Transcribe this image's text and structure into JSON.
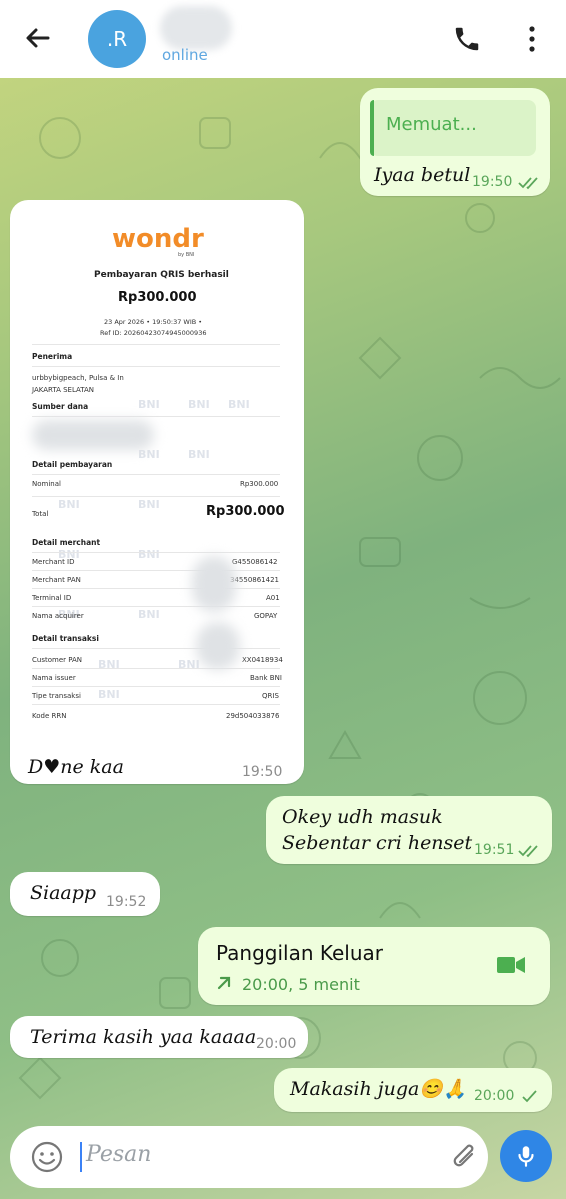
{
  "header": {
    "avatar_initials": ".R",
    "status": "online",
    "icons": [
      "back-arrow-icon",
      "phone-icon",
      "more-vert-icon"
    ]
  },
  "messages": [
    {
      "id": "m1",
      "direction": "out",
      "quote": "Memuat...",
      "text": "Iyaa betul",
      "time": "19:50",
      "status": "read"
    },
    {
      "id": "m2",
      "direction": "in",
      "type": "image",
      "caption": "D♥ne kaa",
      "time": "19:50"
    },
    {
      "id": "m3",
      "direction": "out",
      "lines": [
        "Okey udh masuk",
        "Sebentar cri henset"
      ],
      "time": "19:51",
      "status": "read"
    },
    {
      "id": "m4",
      "direction": "in",
      "text": "Siaapp",
      "time": "19:52"
    },
    {
      "id": "m5",
      "direction": "out",
      "type": "call",
      "title": "Panggilan Keluar",
      "detail": "20:00, 5 menit",
      "icon": "video-camera-icon"
    },
    {
      "id": "m6",
      "direction": "in",
      "text": "Terima kasih yaa kaaaa",
      "time": "20:00"
    },
    {
      "id": "m7",
      "direction": "out",
      "text": "Makasih juga😊🙏",
      "time": "20:00",
      "status": "sent"
    }
  ],
  "receipt": {
    "brand": "wondr",
    "brand_sub": "by BNI",
    "title": "Pembayaran QRIS berhasil",
    "amount": "Rp300.000",
    "datetime": "23 Apr 2026 • 19:50:37 WIB •",
    "ref": "Ref ID: 20260423074945000936",
    "penerima_label": "Penerima",
    "penerima_line1": "urbbybigpeach, Pulsa & In",
    "penerima_line2": "JAKARTA SELATAN",
    "sumber_label": "Sumber dana",
    "detail_pembayaran_label": "Detail pembayaran",
    "nominal_label": "Nominal",
    "nominal_value": "Rp300.000",
    "total_label": "Total",
    "total_value": "Rp300.000",
    "detail_merchant_label": "Detail merchant",
    "merchant_rows": [
      {
        "label": "Merchant ID",
        "value": "G455086142"
      },
      {
        "label": "Merchant PAN",
        "value": "34550861421"
      },
      {
        "label": "Terminal ID",
        "value": "A01"
      },
      {
        "label": "Nama acquirer",
        "value": "GOPAY"
      }
    ],
    "detail_transaksi_label": "Detail transaksi",
    "transaksi_rows": [
      {
        "label": "Customer PAN",
        "value": "XX0418934"
      },
      {
        "label": "Nama issuer",
        "value": "Bank BNI"
      },
      {
        "label": "Tipe transaksi",
        "value": "QRIS"
      },
      {
        "label": "Kode RRN",
        "value": "29d504033876"
      }
    ],
    "watermark": "BNI"
  },
  "input": {
    "placeholder": "Pesan"
  },
  "colors": {
    "accent": "#2f86e6",
    "outgoing_bubble": "#effedd",
    "incoming_bubble": "#ffffff",
    "green": "#4caf50",
    "brand_orange": "#f28c28"
  }
}
